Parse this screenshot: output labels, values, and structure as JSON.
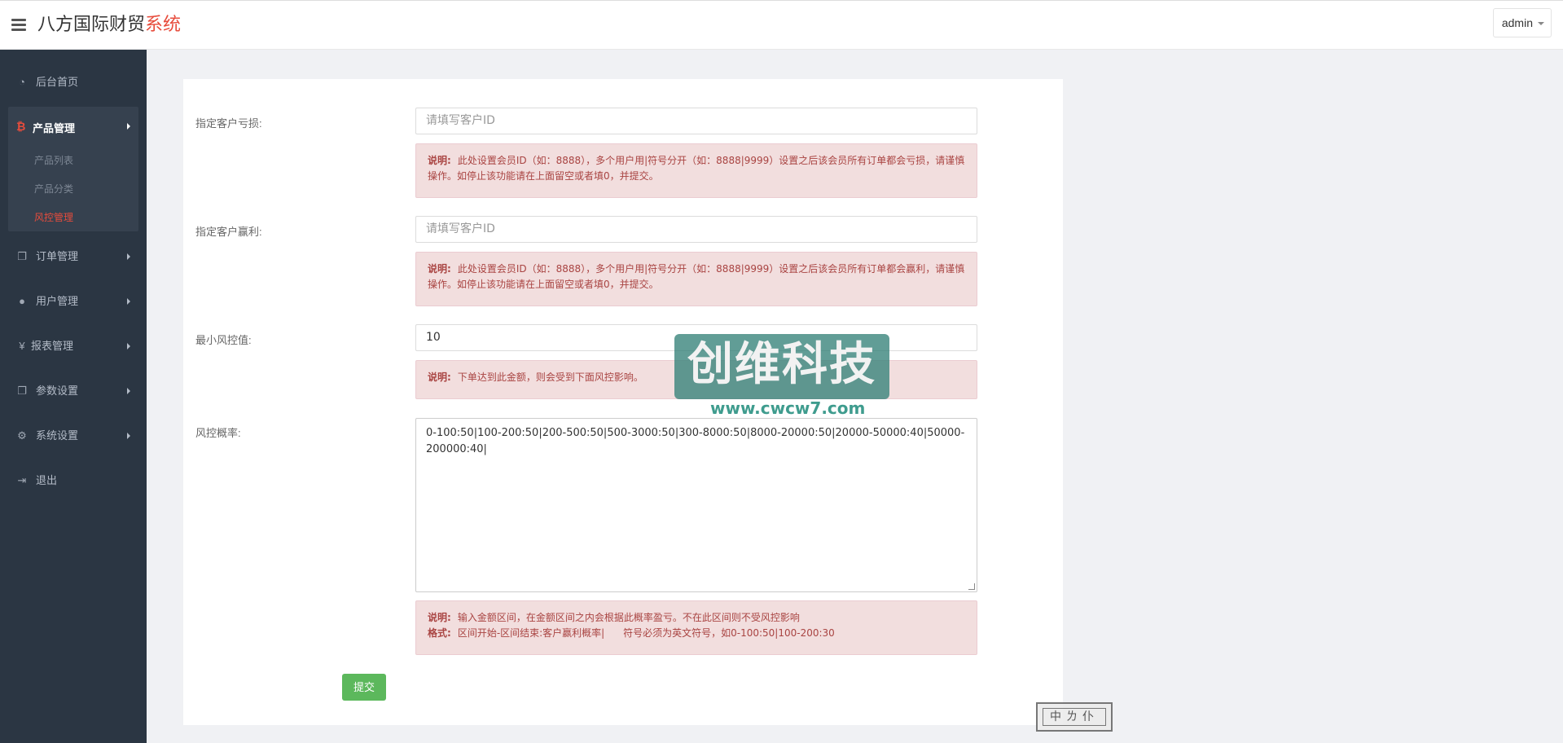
{
  "header": {
    "brand_main": "八方国际财贸",
    "brand_accent": "系统",
    "user": "admin"
  },
  "sidebar": {
    "items": [
      {
        "label": "后台首页",
        "icon": "dashboard-icon"
      },
      {
        "label": "产品管理",
        "icon": "bitcoin-icon"
      },
      {
        "label": "订单管理",
        "icon": "copy-icon"
      },
      {
        "label": "用户管理",
        "icon": "user-icon"
      },
      {
        "label": "报表管理",
        "icon": "yen-icon"
      },
      {
        "label": "参数设置",
        "icon": "copy-icon"
      },
      {
        "label": "系统设置",
        "icon": "gears-icon"
      },
      {
        "label": "退出",
        "icon": "sign-out-icon"
      }
    ],
    "subitems": [
      {
        "label": "产品列表"
      },
      {
        "label": "产品分类"
      },
      {
        "label": "风控管理",
        "active": true
      }
    ]
  },
  "form": {
    "loss": {
      "label": "指定客户亏损:",
      "placeholder": "请填写客户ID",
      "note_title": "说明:",
      "note": "此处设置会员ID（如：8888），多个用户用|符号分开（如：8888|9999）设置之后该会员所有订单都会亏损，请谨慎操作。如停止该功能请在上面留空或者填0，并提交。"
    },
    "profit": {
      "label": "指定客户赢利:",
      "placeholder": "请填写客户ID",
      "note_title": "说明:",
      "note": "此处设置会员ID（如：8888），多个用户用|符号分开（如：8888|9999）设置之后该会员所有订单都会赢利，请谨慎操作。如停止该功能请在上面留空或者填0，并提交。"
    },
    "min_risk": {
      "label": "最小风控值:",
      "value": "10",
      "note_title": "说明:",
      "note": "下单达到此金额，则会受到下面风控影响。"
    },
    "risk_rate": {
      "label": "风控概率:",
      "value": "0-100:50|100-200:50|200-500:50|500-3000:50|300-8000:50|8000-20000:50|20000-50000:40|50000-200000:40|",
      "note_title": "说明:",
      "note": "输入金额区间，在金额区间之内会根据此概率盈亏。不在此区间则不受风控影响",
      "format_title": "格式:",
      "format": "区间开始-区间结束:客户赢利概率|      符号必须为英文符号，如0-100:50|100-200:30"
    },
    "submit_label": "提交"
  },
  "watermark": {
    "text": "创维科技",
    "url": "www.cwcw7.com",
    "seal": "中ㄌ仆"
  }
}
